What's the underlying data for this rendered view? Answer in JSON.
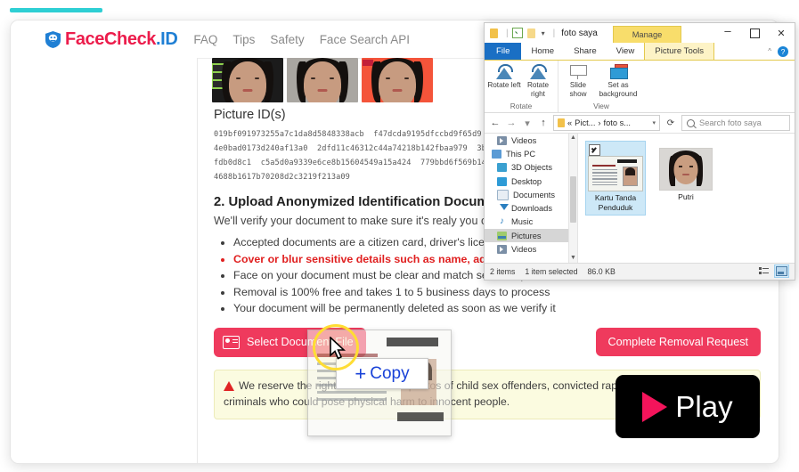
{
  "site": {
    "logo": {
      "primary": "FaceCheck",
      "secondary": ".ID",
      "icon": "shield-icon"
    },
    "nav": [
      "FAQ",
      "Tips",
      "Safety",
      "Face Search API"
    ],
    "accent_pink": "#ef3a5d",
    "accent_blue": "#1f7fd4",
    "accent_teal": "#2ecfd4"
  },
  "content": {
    "picture_ids_label": "Picture ID(s)",
    "picture_ids_lines": [
      "019bf091973255a7c1da8d5848338acb  f47dcda9195dfccbd9f65d9",
      "4e0bad0173d240af13a0  2dfd11c46312c44a74218b142fbaa979  3b",
      "fdb0d8c1  c5a5d0a9339e6ce8b15604549a15a424  779bbd6f569b14",
      "4688b1617b70208d2c3219f213a09"
    ],
    "section_heading": "2. Upload Anonymized Identification Document",
    "section_lead": "We'll verify your document to make sure it's realy you or",
    "rules": [
      {
        "text": "Accepted documents are a citizen card, driver's licen",
        "warn": false
      },
      {
        "text": "Cover or blur sensitive details such as name, add",
        "warn": true
      },
      {
        "text": "Face on your document must be clear and match selected photos",
        "warn": false
      },
      {
        "text": "Removal is 100% free and takes 1 to 5 business days to process",
        "warn": false
      },
      {
        "text": "Your document will be permanently deleted as soon as we verify it",
        "warn": false
      }
    ],
    "select_document_button": "Select Document File",
    "complete_button": "Complete Removal Request",
    "notice": "We reserve the right not to remove photos of child sex offenders, convicted rapists, and other violent criminals who could pose physical harm to innocent people."
  },
  "play_overlay": {
    "label": "Play"
  },
  "explorer": {
    "title": "foto saya",
    "contextual_tab_group": "Manage",
    "tabs": [
      "File",
      "Home",
      "Share",
      "View",
      "Picture Tools"
    ],
    "ribbon_groups": [
      {
        "name": "Rotate",
        "items": [
          {
            "label": "Rotate left",
            "icon": "rotate-left-icon"
          },
          {
            "label": "Rotate right",
            "icon": "rotate-right-icon"
          }
        ]
      },
      {
        "name": "View",
        "items": [
          {
            "label": "Slide show",
            "icon": "slideshow-icon"
          },
          {
            "label": "Set as background",
            "icon": "set-background-icon"
          }
        ]
      }
    ],
    "address": {
      "crumb_1": "Pict...",
      "crumb_2": "foto s..."
    },
    "search_placeholder": "Search foto saya",
    "tree": [
      {
        "label": "Videos",
        "icon": "video-icon",
        "selected": false,
        "indent": 1
      },
      {
        "label": "This PC",
        "icon": "pc-icon",
        "selected": false,
        "indent": 0
      },
      {
        "label": "3D Objects",
        "icon": "cube-icon",
        "selected": false,
        "indent": 1
      },
      {
        "label": "Desktop",
        "icon": "desktop-icon",
        "selected": false,
        "indent": 1
      },
      {
        "label": "Documents",
        "icon": "documents-icon",
        "selected": false,
        "indent": 1
      },
      {
        "label": "Downloads",
        "icon": "downloads-icon",
        "selected": false,
        "indent": 1
      },
      {
        "label": "Music",
        "icon": "music-icon",
        "selected": false,
        "indent": 1
      },
      {
        "label": "Pictures",
        "icon": "pictures-icon",
        "selected": true,
        "indent": 1
      },
      {
        "label": "Videos",
        "icon": "video-icon",
        "selected": false,
        "indent": 1
      }
    ],
    "files": [
      {
        "name": "Kartu Tanda Penduduk",
        "selected": true,
        "thumb": "id-card"
      },
      {
        "name": "Putri",
        "selected": false,
        "thumb": "portrait"
      }
    ],
    "status": {
      "items": "2 items",
      "selection": "1 item selected",
      "size": "86.0 KB"
    },
    "window_controls": {
      "minimize": "–",
      "maximize": "□",
      "close": "✕"
    },
    "help_icon": "help-icon",
    "view_buttons": [
      "details-view-icon",
      "large-icons-view-icon"
    ]
  },
  "drag": {
    "tooltip_symbol": "+",
    "tooltip_label": "Copy"
  }
}
